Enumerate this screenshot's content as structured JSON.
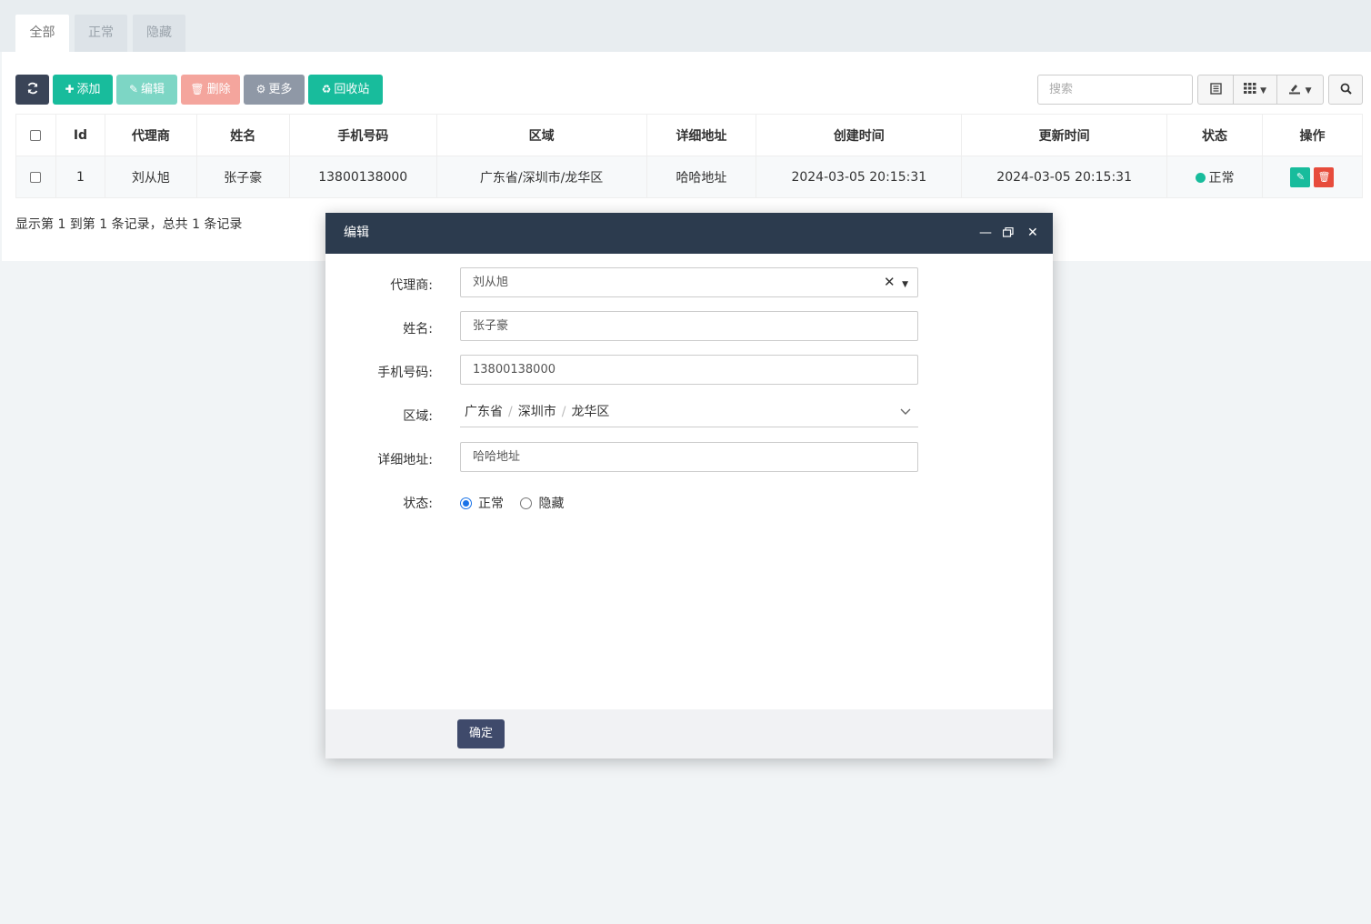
{
  "tabs": [
    {
      "label": "全部",
      "active": true
    },
    {
      "label": "正常",
      "active": false
    },
    {
      "label": "隐藏",
      "active": false
    }
  ],
  "toolbar": {
    "refresh_icon": "⟳",
    "add_label": "添加",
    "edit_label": "编辑",
    "delete_label": "删除",
    "more_label": "更多",
    "recycle_label": "回收站"
  },
  "search": {
    "placeholder": "搜索"
  },
  "table": {
    "headers": [
      "Id",
      "代理商",
      "姓名",
      "手机号码",
      "区域",
      "详细地址",
      "创建时间",
      "更新时间",
      "状态",
      "操作"
    ],
    "rows": [
      {
        "id": "1",
        "agent": "刘从旭",
        "name": "张子豪",
        "phone": "13800138000",
        "region": "广东省/深圳市/龙华区",
        "address": "哈哈地址",
        "created": "2024-03-05 20:15:31",
        "updated": "2024-03-05 20:15:31",
        "status": "正常"
      }
    ]
  },
  "footer_info": "显示第 1 到第 1 条记录，总共 1 条记录",
  "modal": {
    "title": "编辑",
    "fields": {
      "agent_label": "代理商:",
      "agent_value": "刘从旭",
      "name_label": "姓名:",
      "name_value": "张子豪",
      "phone_label": "手机号码:",
      "phone_value": "13800138000",
      "region_label": "区域:",
      "region_parts": [
        "广东省",
        "深圳市",
        "龙华区"
      ],
      "address_label": "详细地址:",
      "address_value": "哈哈地址",
      "status_label": "状态:",
      "status_options": [
        "正常",
        "隐藏"
      ],
      "status_selected": "正常"
    },
    "ok_label": "确定"
  },
  "colors": {
    "success": "#18bc9c",
    "danger": "#e74c3c",
    "dark_header": "#2c3b4e"
  }
}
